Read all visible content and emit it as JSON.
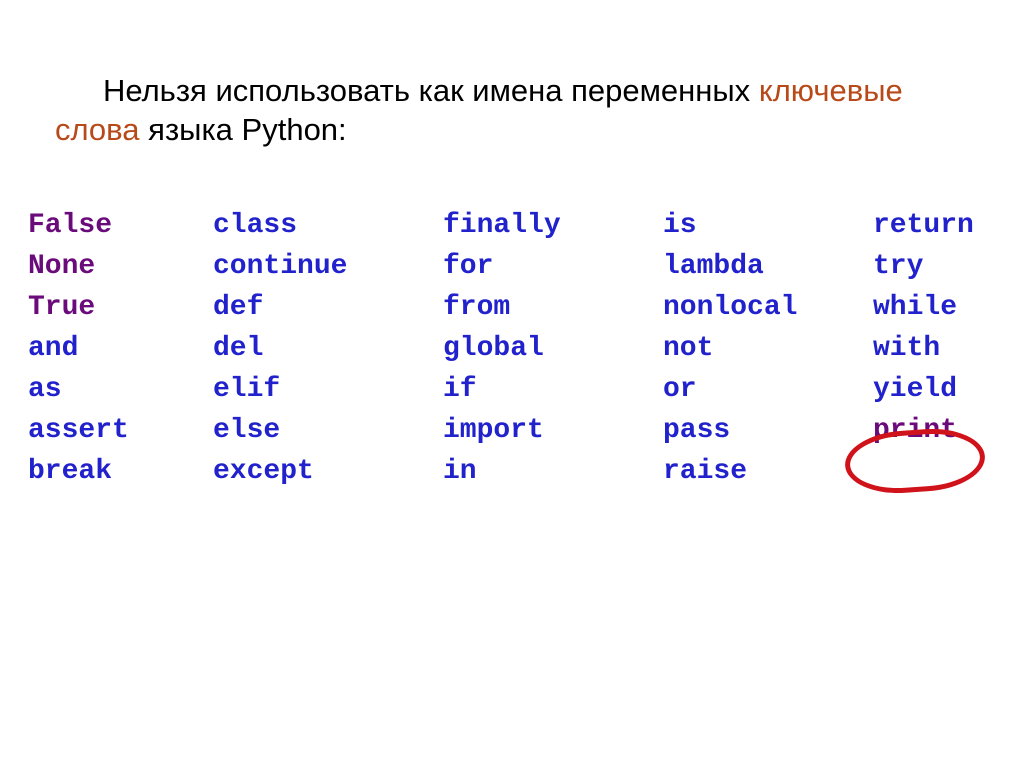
{
  "heading": {
    "pre": "Нельзя использовать как имена переменных ",
    "accent": "ключевые слова",
    "post": " языка Python:"
  },
  "colors": {
    "builtin": "#6b0a7a",
    "green": "#1a7a1a",
    "blue": "#2222cc",
    "circle": "#d0121b"
  },
  "circled_keyword": "print",
  "keywords": {
    "rows": [
      [
        {
          "t": "False",
          "c": "builtin"
        },
        {
          "t": "class",
          "c": "blue"
        },
        {
          "t": "finally",
          "c": "blue"
        },
        {
          "t": "is",
          "c": "blue"
        },
        {
          "t": "return",
          "c": "blue"
        }
      ],
      [
        {
          "t": "None",
          "c": "builtin"
        },
        {
          "t": "continue",
          "c": "blue"
        },
        {
          "t": "for",
          "c": "blue"
        },
        {
          "t": "lambda",
          "c": "blue"
        },
        {
          "t": "try",
          "c": "blue"
        }
      ],
      [
        {
          "t": "True",
          "c": "builtin"
        },
        {
          "t": "def",
          "c": "blue"
        },
        {
          "t": "from",
          "c": "blue"
        },
        {
          "t": "nonlocal",
          "c": "blue"
        },
        {
          "t": "while",
          "c": "blue"
        }
      ],
      [
        {
          "t": "and",
          "c": "blue"
        },
        {
          "t": "del",
          "c": "blue"
        },
        {
          "t": "global",
          "c": "blue"
        },
        {
          "t": "not",
          "c": "blue"
        },
        {
          "t": "with",
          "c": "blue"
        }
      ],
      [
        {
          "t": "as",
          "c": "blue"
        },
        {
          "t": "elif",
          "c": "blue"
        },
        {
          "t": "if",
          "c": "blue"
        },
        {
          "t": "or",
          "c": "blue"
        },
        {
          "t": "yield",
          "c": "blue"
        }
      ],
      [
        {
          "t": "assert",
          "c": "blue"
        },
        {
          "t": "else",
          "c": "blue"
        },
        {
          "t": "import",
          "c": "blue"
        },
        {
          "t": "pass",
          "c": "blue"
        },
        {
          "t": "print",
          "c": "builtin"
        }
      ],
      [
        {
          "t": "break",
          "c": "blue"
        },
        {
          "t": "except",
          "c": "blue"
        },
        {
          "t": "in",
          "c": "blue"
        },
        {
          "t": "raise",
          "c": "blue"
        },
        {
          "t": "",
          "c": "blue"
        }
      ]
    ]
  }
}
